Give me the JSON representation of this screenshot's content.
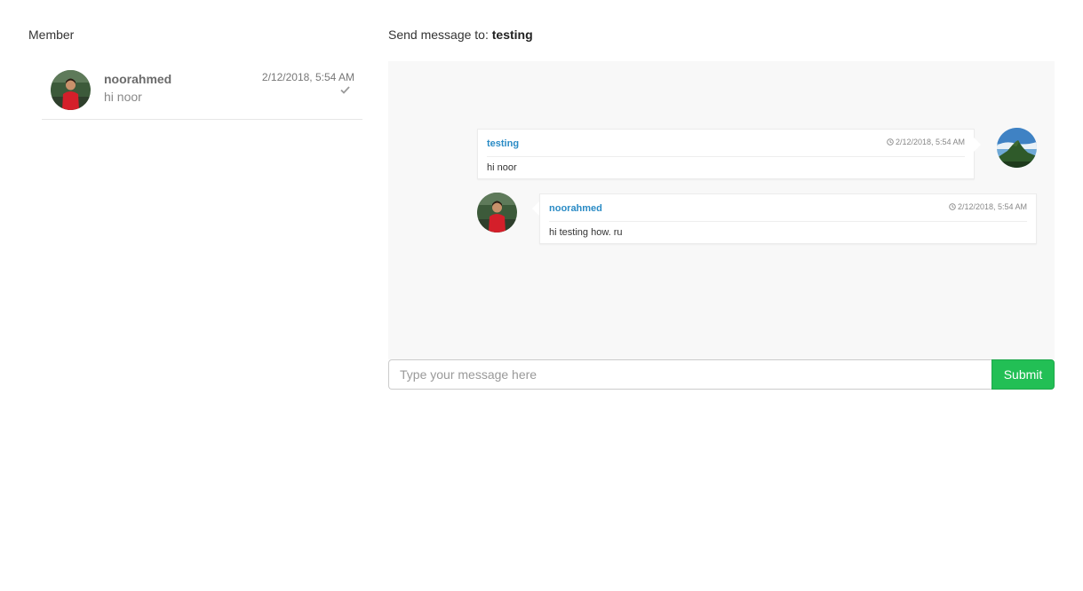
{
  "sidebar": {
    "title": "Member",
    "members": [
      {
        "name": "noorahmed",
        "last_message": "hi noor",
        "time": "2/12/2018, 5:54 AM",
        "status_icon": "check-icon"
      }
    ]
  },
  "chat": {
    "send_to_label": "Send message to:",
    "recipient": "testing",
    "messages": [
      {
        "user": "testing",
        "time": "2/12/2018, 5:54 AM",
        "text": "hi noor",
        "direction": "outgoing",
        "avatar": "mountain-landscape"
      },
      {
        "user": "noorahmed",
        "time": "2/12/2018, 5:54 AM",
        "text": "hi testing how. ru",
        "direction": "incoming",
        "avatar": "person-red-shirt"
      }
    ]
  },
  "composer": {
    "placeholder": "Type your message here",
    "value": "",
    "submit_label": "Submit"
  },
  "colors": {
    "username_link": "#2a8bc5",
    "submit_button": "#22bf55",
    "chat_background": "#f8f8f8"
  }
}
